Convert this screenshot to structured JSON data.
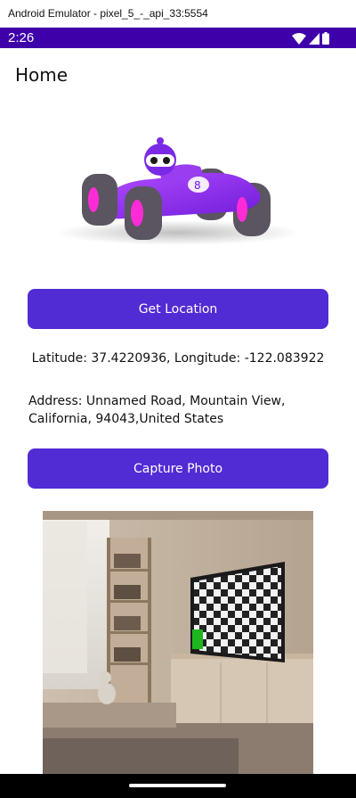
{
  "emulator": {
    "title": "Android Emulator - pixel_5_-_api_33:5554"
  },
  "status_bar": {
    "time": "2:26",
    "icons": [
      "wifi-icon",
      "cell-signal-icon",
      "battery-icon"
    ],
    "color": "#3e00a9"
  },
  "page": {
    "title": "Home"
  },
  "hero_image": {
    "icon": "race-car-robot-illustration"
  },
  "buttons": {
    "get_location": "Get Location",
    "capture_photo": "Capture Photo",
    "color": "#512bd4"
  },
  "location": {
    "latlon_text": "Latitude: 37.4220936, Longitude: -122.083922",
    "address_text": "Address: Unnamed Road, Mountain View, California, 94043,United States"
  },
  "photo": {
    "icon": "captured-room-photo"
  }
}
